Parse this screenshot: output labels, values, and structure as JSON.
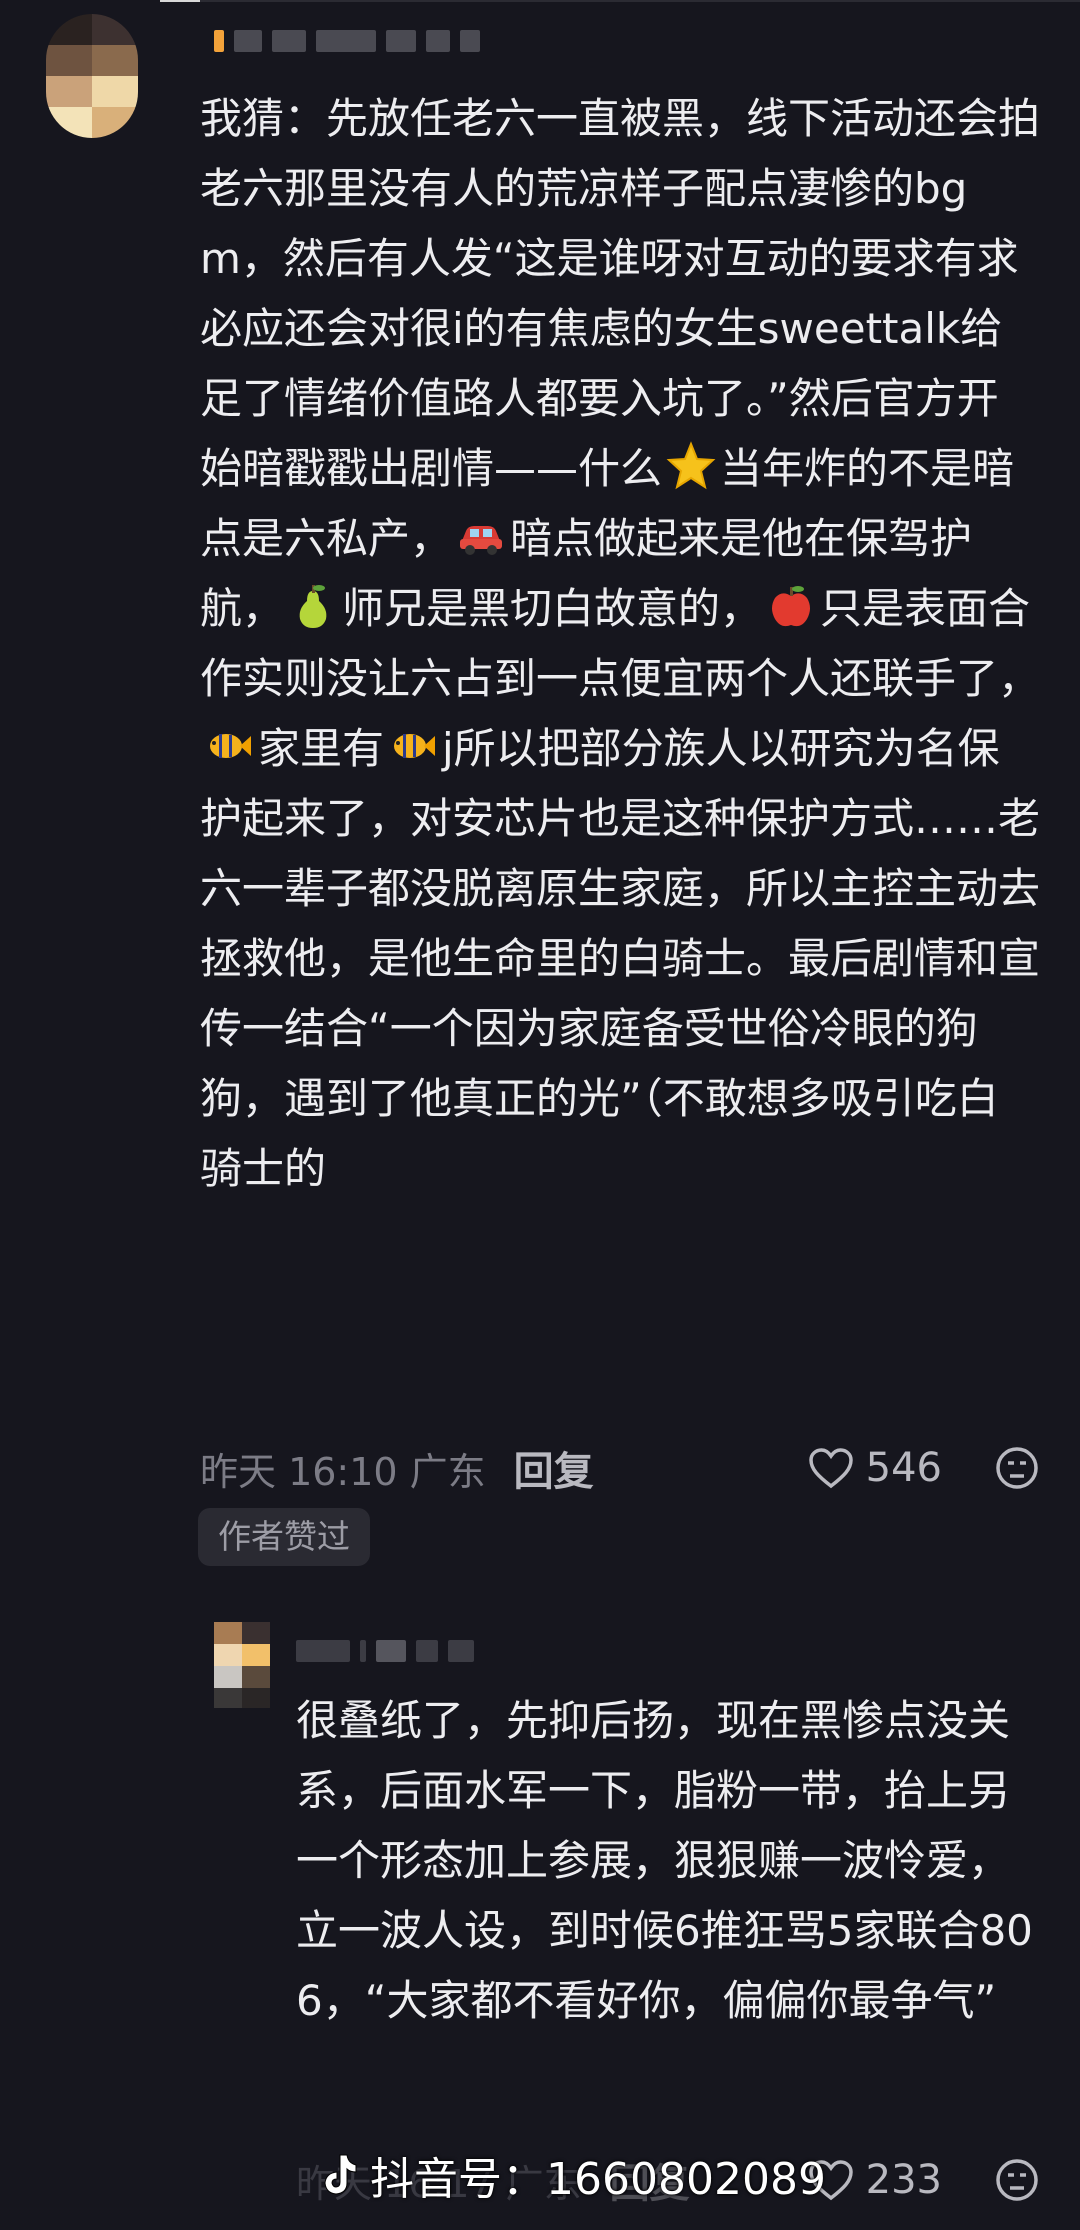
{
  "main_comment": {
    "text_parts": [
      "我猜：先放任老六一直被黑，线下活动还会拍老六那里没有人的荒凉样子配点凄惨的bgm，然后有人发“这是谁呀对互动的要求有求必应还会对很i的有焦虑的女生sweettalk给足了情绪价值路人都要入坑了。”然后官方开始暗戳戳出剧情——什么",
      "当年炸的不是暗点是六私产，",
      "暗点做起来是他在保驾护航，",
      "师兄是黑切白故意的，",
      "只是表面合作实则没让六占到一点便宜两个人还联手了，",
      "家里有",
      "j所以把部分族人以研究为名保护起来了，对安芯片也是这种保护方式……老六一辈子都没脱离原生家庭，所以主控主动去拯救他，是他生命里的白骑士。最后剧情和宣传一结合“一个因为家庭备受世俗冷眼的狗狗，遇到了他真正的光”（不敢想多吸引吃白骑士的"
    ],
    "emojis": [
      "star-emoji",
      "car-emoji",
      "pear-emoji",
      "apple-emoji",
      "fish-emoji",
      "fish-emoji"
    ],
    "time": "昨天 16:10 广东",
    "reply_label": "回复",
    "likes": "546",
    "author_badge": "作者赞过"
  },
  "reply_comment": {
    "text": "很叠纸了，先抑后扬，现在黑惨点没关系，后面水军一下，脂粉一带，抬上另一个形态加上参展，狠狠赚一波怜爱，立一波人设，到时候6推狂骂5家联合80 6，“大家都不看好你，偏偏你最争气”",
    "time": "昨天 16:17 广东",
    "reply_label": "回复",
    "likes": "233"
  },
  "watermark": {
    "text": "抖音号：1660802089"
  },
  "colors": {
    "background": "#16161e",
    "text": "#ededf0",
    "meta": "#7c7c86"
  }
}
